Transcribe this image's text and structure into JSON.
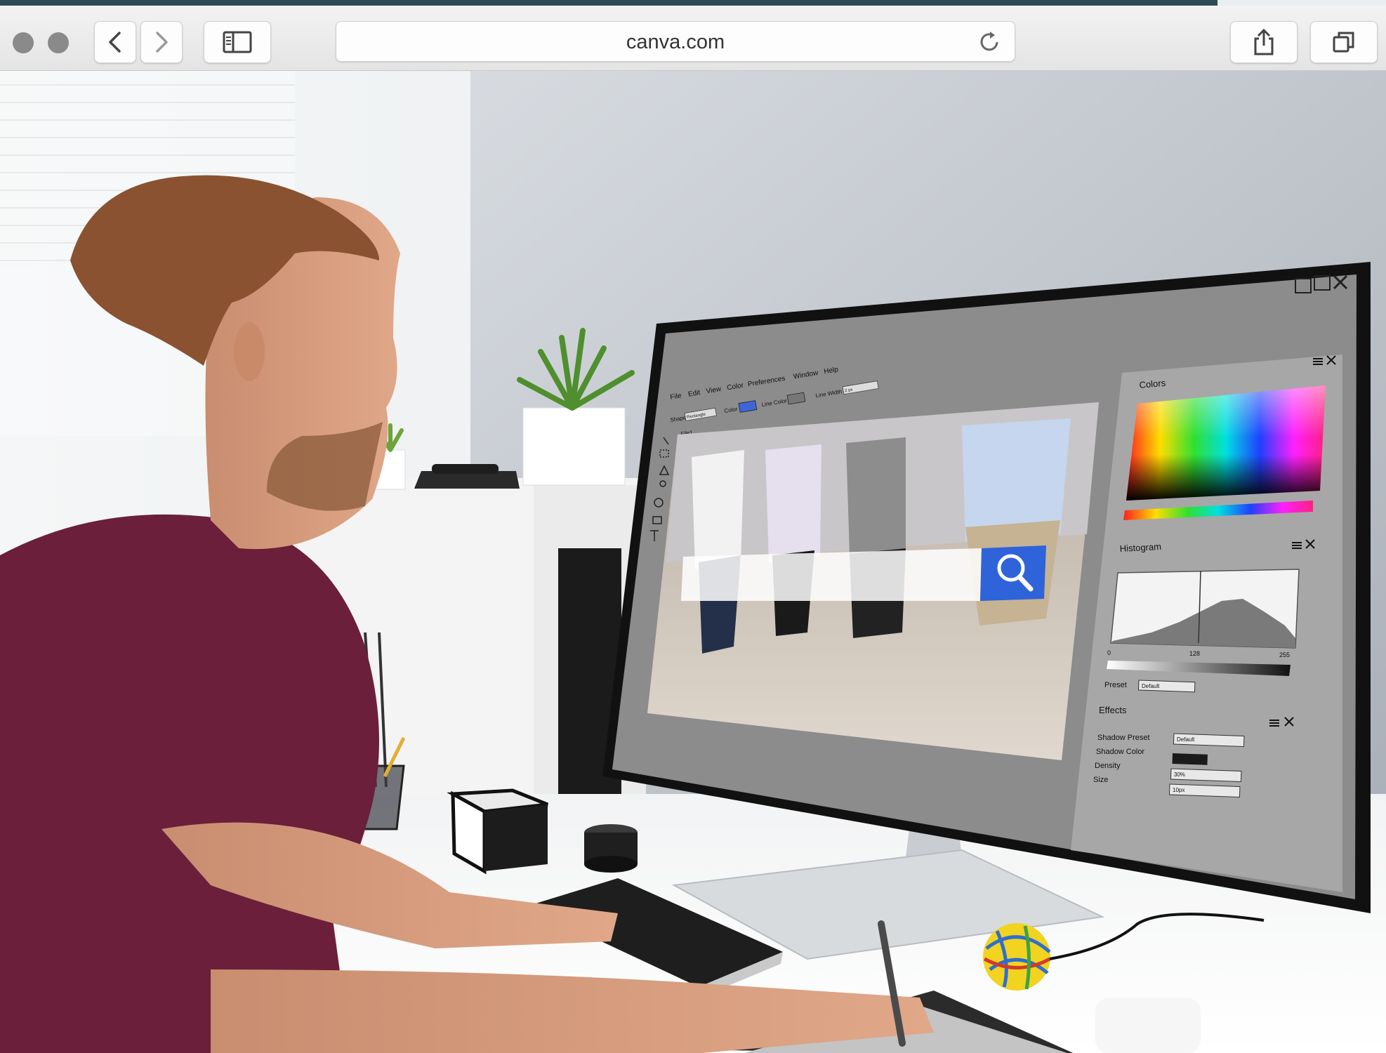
{
  "browser": {
    "url": "canva.com",
    "tab_icons": [
      "back-icon",
      "forward-icon",
      "sidebar-icon",
      "reload-icon",
      "share-icon",
      "tabs-icon"
    ]
  },
  "photo": {
    "editor_menu": [
      "File",
      "Edit",
      "View",
      "Color",
      "Preferences",
      "Window",
      "Help"
    ],
    "editor_options": {
      "shape_label": "Shape",
      "shape_value": "Rectangle",
      "color_label": "Color",
      "line_color_label": "Line Color",
      "line_width_label": "Line Width",
      "line_width_value": "2 px"
    },
    "file_tab": "File1",
    "panels": {
      "colors_title": "Colors",
      "histogram_title": "Histogram",
      "histogram_ticks": [
        "0",
        "128",
        "255"
      ],
      "preset_label": "Preset",
      "preset_value": "Default",
      "effects_title": "Effects",
      "effects": [
        {
          "label": "Shadow Preset",
          "value": "Default"
        },
        {
          "label": "Shadow Color",
          "value": ""
        },
        {
          "label": "Density",
          "value": "30%"
        },
        {
          "label": "Size",
          "value": "10px"
        }
      ]
    },
    "colors": {
      "search_blue": "#2f63d9",
      "shirt": "#6b1f3a",
      "monitor_gray": "#8c8c8c"
    }
  }
}
